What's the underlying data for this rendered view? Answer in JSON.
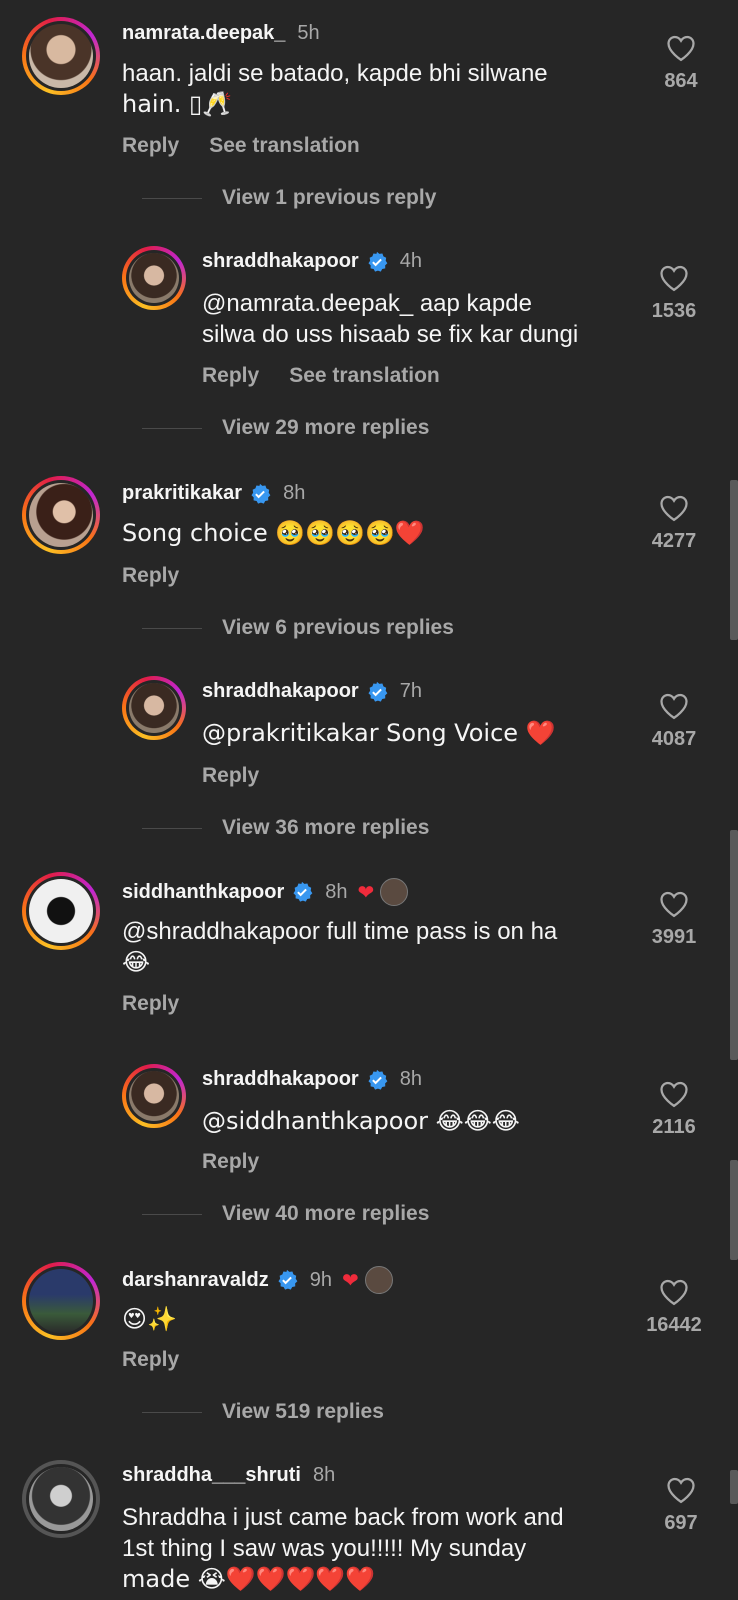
{
  "comments": [
    {
      "username": "namrata.deepak_",
      "time": "5h",
      "text": "haan. jaldi se batado, kapde bhi silwane hain. 🥂",
      "text_line1": "haan. jaldi se batado, kapde bhi silwane",
      "text_line2": "hain. ▯🥂",
      "reply": "Reply",
      "translation": "See translation",
      "likes": "864",
      "view_replies": "View 1 previous reply"
    },
    {
      "username": "shraddhakapoor",
      "time": "4h",
      "text_line1": "@namrata.deepak_ aap kapde",
      "text_line2": "silwa do uss hisaab se fix kar dungi",
      "reply": "Reply",
      "translation": "See translation",
      "likes": "1536",
      "view_replies": "View 29 more replies"
    },
    {
      "username": "prakritikakar",
      "time": "8h",
      "text": "Song choice 🥹🥹🥹🥹❤️",
      "reply": "Reply",
      "likes": "4277",
      "view_replies": "View 6 previous replies"
    },
    {
      "username": "shraddhakapoor",
      "time": "7h",
      "text": "@prakritikakar Song Voice ❤️",
      "reply": "Reply",
      "likes": "4087",
      "view_replies": "View 36 more replies"
    },
    {
      "username": "siddhanthkapoor",
      "time": "8h",
      "text_line1": "@shraddhakapoor full time pass is on ha",
      "text_line2": "😂",
      "reply": "Reply",
      "likes": "3991"
    },
    {
      "username": "shraddhakapoor",
      "time": "8h",
      "text": "@siddhanthkapoor 😂😂😂",
      "reply": "Reply",
      "likes": "2116",
      "view_replies": "View 40 more replies"
    },
    {
      "username": "darshanravaldz",
      "time": "9h",
      "text": "😍✨",
      "reply": "Reply",
      "likes": "16442",
      "view_replies": "View 519 replies"
    },
    {
      "username": "shraddha___shruti",
      "time": "8h",
      "text_line1": "Shraddha i just came back from work and",
      "text_line2": "1st thing I saw was you!!!!! My sunday",
      "text_line3": "made 😭❤️❤️❤️❤️❤️",
      "likes": "697"
    }
  ],
  "colors": {
    "background": "#262626",
    "secondary_text": "#a8a8a8",
    "verified": "#3897f0",
    "heart": "#ef2b3b"
  },
  "icons": {
    "like": "heart-outline-icon",
    "verified": "verified-badge-icon",
    "liked_by_creator": "red-heart-icon"
  }
}
